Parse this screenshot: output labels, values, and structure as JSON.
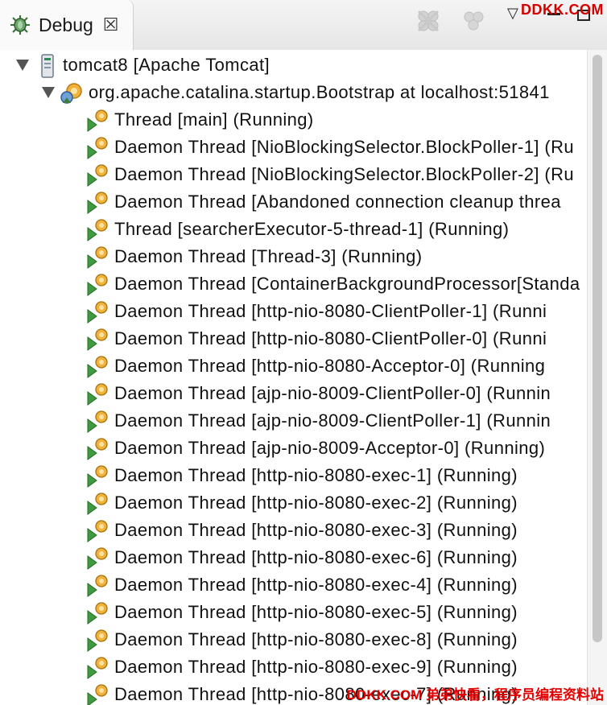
{
  "view_tab": {
    "title": "Debug",
    "close_glyph": "☒"
  },
  "toolbar": {
    "icons": [
      "remove-terminated-icon",
      "remove-all-terminated-icon"
    ],
    "menu_glyph": "▽"
  },
  "watermark": {
    "top": "DDKK.COM",
    "bottom": "DDKK.COM 弟弟快看，程序员编程资料站"
  },
  "tree": {
    "server": "tomcat8 [Apache Tomcat]",
    "vm": "org.apache.catalina.startup.Bootstrap at localhost:51841",
    "threads": [
      "Thread [main] (Running)",
      "Daemon Thread [NioBlockingSelector.BlockPoller-1] (Ru",
      "Daemon Thread [NioBlockingSelector.BlockPoller-2] (Ru",
      "Daemon Thread [Abandoned connection cleanup threa",
      "Thread [searcherExecutor-5-thread-1] (Running)",
      "Daemon Thread [Thread-3] (Running)",
      "Daemon Thread [ContainerBackgroundProcessor[Standa",
      "Daemon Thread [http-nio-8080-ClientPoller-1] (Runni",
      "Daemon Thread [http-nio-8080-ClientPoller-0] (Runni",
      "Daemon Thread [http-nio-8080-Acceptor-0] (Running",
      "Daemon Thread [ajp-nio-8009-ClientPoller-0] (Runnin",
      "Daemon Thread [ajp-nio-8009-ClientPoller-1] (Runnin",
      "Daemon Thread [ajp-nio-8009-Acceptor-0] (Running)",
      "Daemon Thread [http-nio-8080-exec-1] (Running)",
      "Daemon Thread [http-nio-8080-exec-2] (Running)",
      "Daemon Thread [http-nio-8080-exec-3] (Running)",
      "Daemon Thread [http-nio-8080-exec-6] (Running)",
      "Daemon Thread [http-nio-8080-exec-4] (Running)",
      "Daemon Thread [http-nio-8080-exec-5] (Running)",
      "Daemon Thread [http-nio-8080-exec-8] (Running)",
      "Daemon Thread [http-nio-8080-exec-9] (Running)",
      "Daemon Thread [http-nio-8080-exec-7] (Running)"
    ]
  }
}
